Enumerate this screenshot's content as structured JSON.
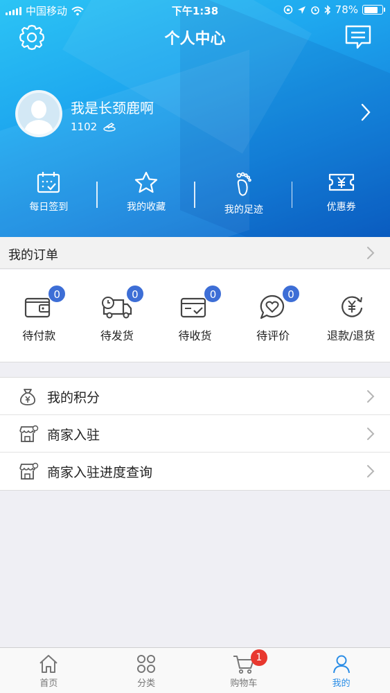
{
  "status_bar": {
    "carrier": "中国移动",
    "time": "下午1:38",
    "battery": "78%",
    "battery_level": 0.78
  },
  "header": {
    "title": "个人中心",
    "settings_icon": "gear-icon",
    "message_icon": "message-icon"
  },
  "profile": {
    "name": "我是长颈鹿啊",
    "points": "1102"
  },
  "quick_actions": [
    {
      "label": "每日签到",
      "icon": "calendar-check-icon"
    },
    {
      "label": "我的收藏",
      "icon": "star-icon"
    },
    {
      "label": "我的足迹",
      "icon": "footprint-icon"
    },
    {
      "label": "优惠券",
      "icon": "coupon-icon"
    }
  ],
  "orders": {
    "title": "我的订单",
    "items": [
      {
        "label": "待付款",
        "badge": "0",
        "icon": "wallet-icon"
      },
      {
        "label": "待发货",
        "badge": "0",
        "icon": "truck-icon"
      },
      {
        "label": "待收货",
        "badge": "0",
        "icon": "package-received-icon"
      },
      {
        "label": "待评价",
        "badge": "0",
        "icon": "review-heart-icon"
      },
      {
        "label": "退款/退货",
        "icon": "refund-icon"
      }
    ]
  },
  "menu": [
    {
      "label": "我的积分",
      "icon": "money-bag-icon"
    },
    {
      "label": "商家入驻",
      "icon": "store-icon"
    },
    {
      "label": "商家入驻进度查询",
      "icon": "store-progress-icon"
    }
  ],
  "tabs": [
    {
      "label": "首页",
      "icon": "home-icon"
    },
    {
      "label": "分类",
      "icon": "category-icon"
    },
    {
      "label": "购物车",
      "icon": "cart-icon",
      "badge": "1"
    },
    {
      "label": "我的",
      "icon": "user-icon",
      "active": true
    }
  ],
  "colors": {
    "accent": "#2a8de6",
    "badge_blue": "#3d6ed6",
    "badge_red": "#e8382f",
    "header_gradient_start": "#2cc4f5",
    "header_gradient_end": "#0c62c6"
  }
}
